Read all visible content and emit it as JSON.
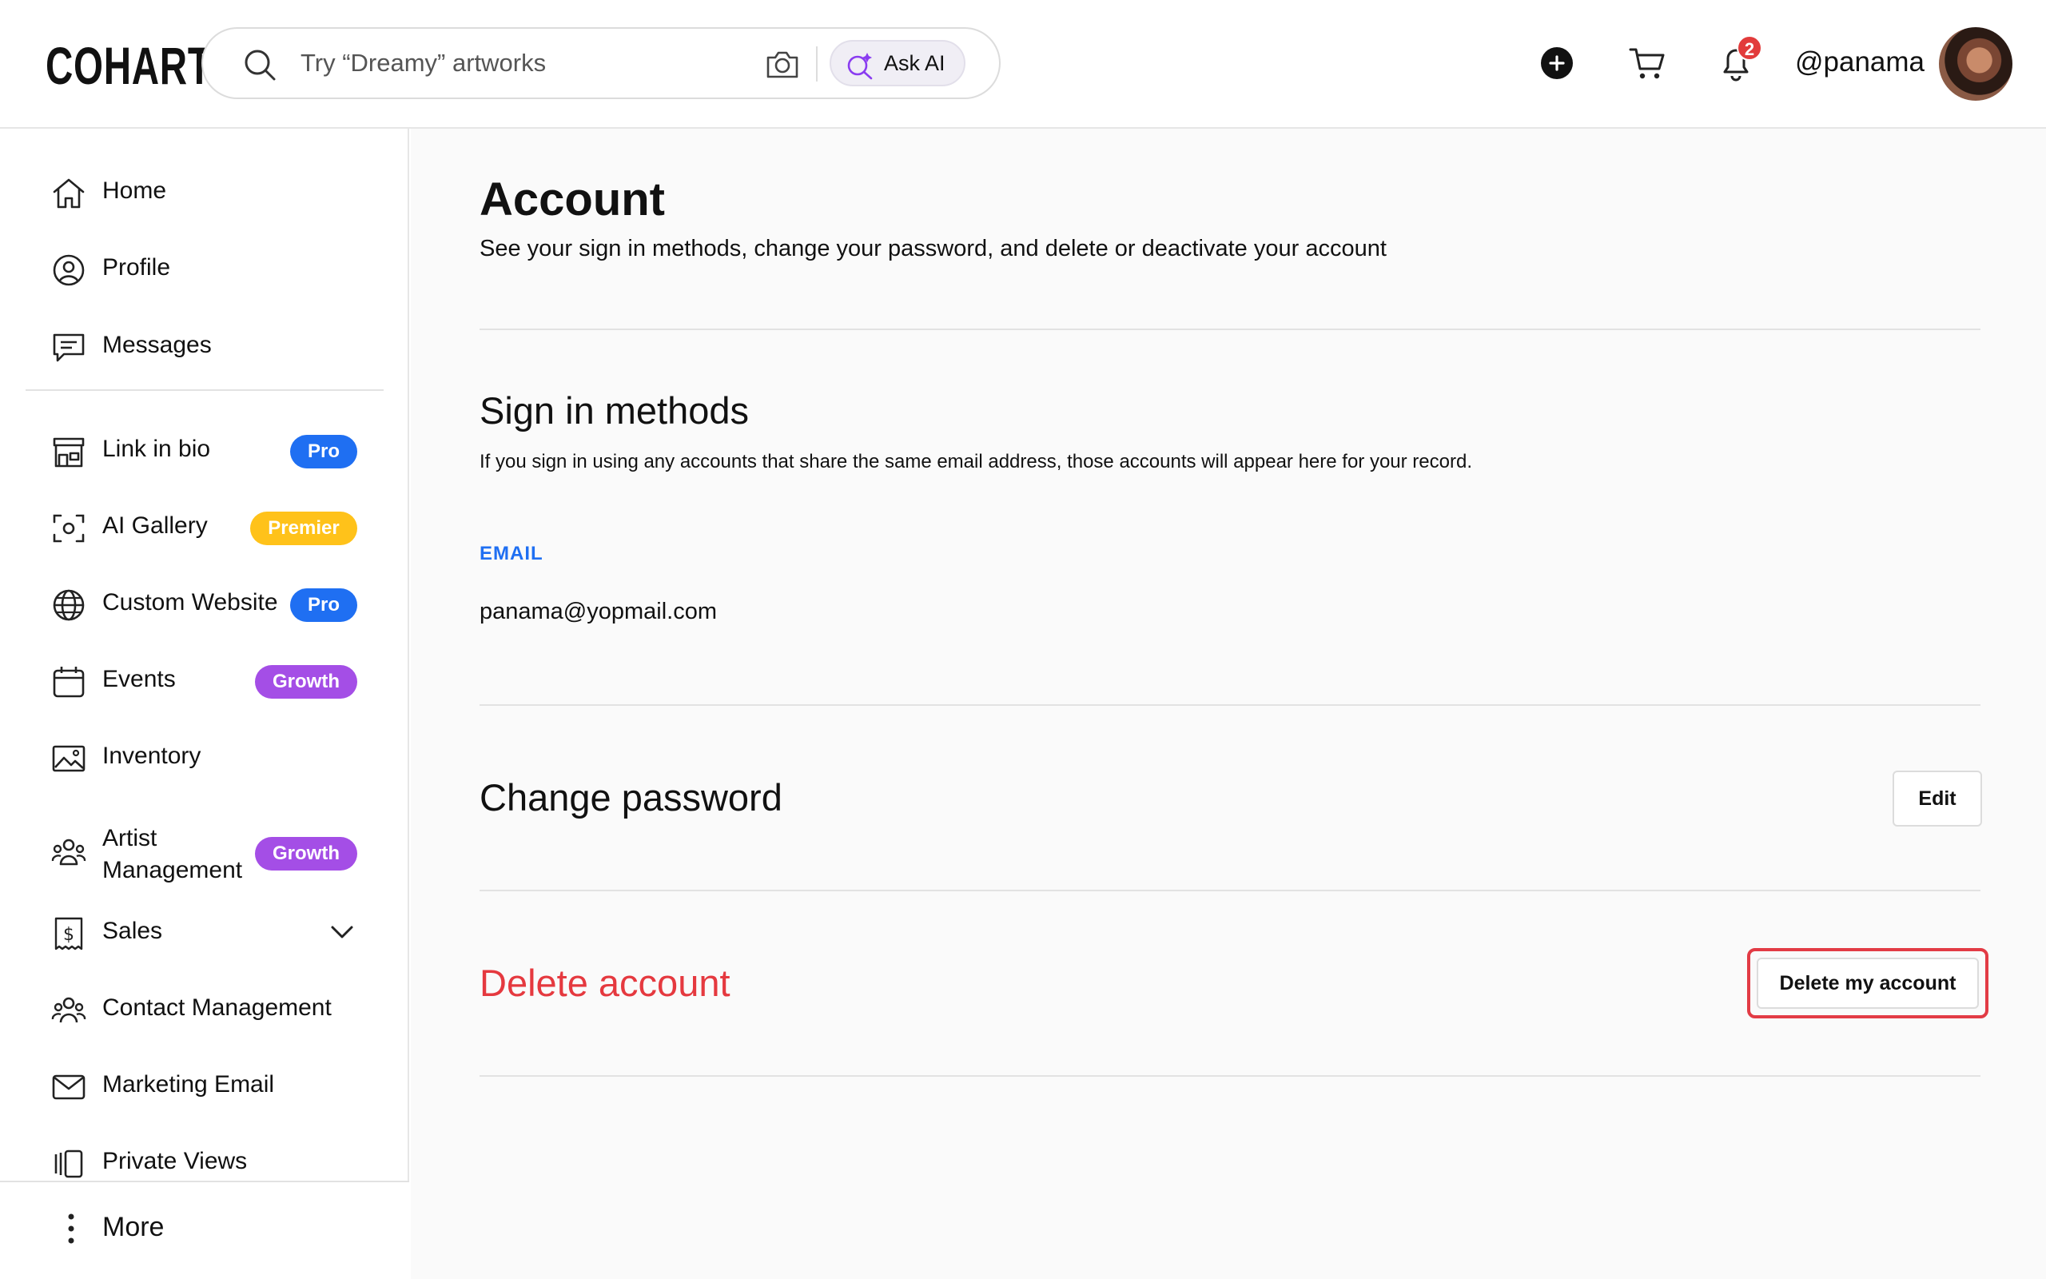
{
  "brand": {
    "logo": "COHART"
  },
  "search": {
    "placeholder": "Try “Dreamy” artworks",
    "ask_ai": "Ask AI"
  },
  "header": {
    "notifications_count": "2",
    "username": "@panama"
  },
  "sidebar": {
    "items": [
      {
        "label": "Home",
        "icon": "home-icon"
      },
      {
        "label": "Profile",
        "icon": "profile-icon"
      },
      {
        "label": "Messages",
        "icon": "messages-icon"
      },
      {
        "label": "Link in bio",
        "icon": "storefront-icon",
        "badge": "Pro"
      },
      {
        "label": "AI Gallery",
        "icon": "ai-scan-icon",
        "badge": "Premier"
      },
      {
        "label": "Custom Website",
        "icon": "globe-icon",
        "badge": "Pro"
      },
      {
        "label": "Events",
        "icon": "calendar-icon",
        "badge": "Growth"
      },
      {
        "label": "Inventory",
        "icon": "image-icon"
      },
      {
        "label": "Artist Management",
        "icon": "people-icon",
        "badge": "Growth"
      },
      {
        "label": "Sales",
        "icon": "dollar-receipt-icon"
      },
      {
        "label": "Contact Management",
        "icon": "contacts-icon"
      },
      {
        "label": "Marketing Email",
        "icon": "mail-icon"
      },
      {
        "label": "Private Views",
        "icon": "private-views-icon"
      }
    ],
    "more": "More"
  },
  "badge_colors": {
    "Pro": "#1f6ff2",
    "Premier": "#ffc21a",
    "Growth": "#a44ee6"
  },
  "account": {
    "title": "Account",
    "description": "See your sign in methods, change your password, and delete or deactivate your account",
    "sign_in": {
      "title": "Sign in methods",
      "description": "If you sign in using any accounts that share the same email address, those accounts will appear here for your record.",
      "email_label": "EMAIL",
      "email_value": "panama@yopmail.com"
    },
    "change_password": {
      "title": "Change password",
      "edit_label": "Edit"
    },
    "delete": {
      "title": "Delete account",
      "button_label": "Delete my account"
    }
  }
}
